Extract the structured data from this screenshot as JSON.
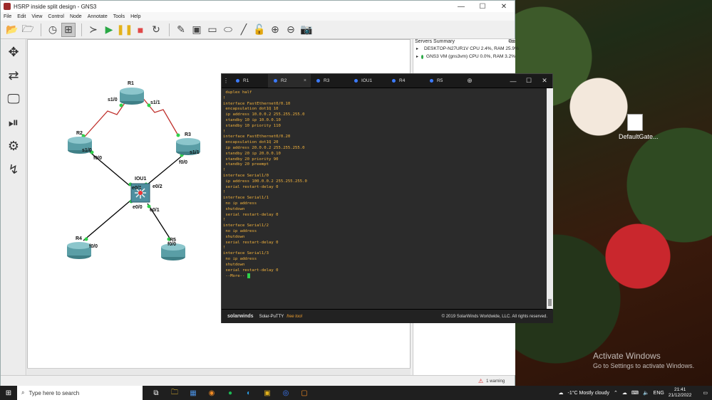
{
  "window": {
    "title": "HSRP inside split design - GNS3",
    "controls": [
      "—",
      "☐",
      "✕"
    ]
  },
  "menu": [
    "File",
    "Edit",
    "View",
    "Control",
    "Node",
    "Annotate",
    "Tools",
    "Help"
  ],
  "servers": {
    "title": "Servers Summary",
    "items": [
      {
        "label": "DESKTOP-N27UR1V CPU 2.4%, RAM 25.9%"
      },
      {
        "label": "GNS3 VM (gns3vm) CPU 0.0%, RAM 3.2%"
      }
    ]
  },
  "topology": {
    "nodes": {
      "R1": "R1",
      "R2": "R2",
      "R3": "R3",
      "IOU1": "IOU1",
      "R4": "R4",
      "R5": "R5"
    },
    "ports": {
      "r1_s10": "s1/0",
      "r1_s11": "s1/1",
      "r2_s10": "s1/0",
      "r2_f00": "f0/0",
      "r3_s11": "s1/1",
      "r3_f00": "f0/0",
      "iou_e01": "e0/1",
      "iou_e02": "e0/2",
      "iou_e00": "e0/0",
      "iou_e01b": "e0/1",
      "r4_f00": "f0/0",
      "r5_f00": "f0/0"
    }
  },
  "status": {
    "warning": "1 warning"
  },
  "putty": {
    "tabs": [
      "R1",
      "R2",
      "R3",
      "IOU1",
      "R4",
      "R5"
    ],
    "active_tab_close": "×",
    "terminal_lines": [
      " duplex half",
      "!",
      "interface FastEthernet0/0.10",
      " encapsulation dot1Q 10",
      " ip address 10.0.0.2 255.255.255.0",
      " standby 10 ip 10.0.0.10",
      " standby 10 priority 110",
      "!",
      "interface FastEthernet0/0.20",
      " encapsulation dot1Q 20",
      " ip address 20.0.0.2 255.255.255.0",
      " standby 20 ip 20.0.0.10",
      " standby 20 priority 90",
      " standby 20 preempt",
      "!",
      "interface Serial1/0",
      " ip address 100.0.0.2 255.255.255.0",
      " serial restart-delay 0",
      "!",
      "interface Serial1/1",
      " no ip address",
      " shutdown",
      " serial restart-delay 0",
      "!",
      "interface Serial1/2",
      " no ip address",
      " shutdown",
      " serial restart-delay 0",
      "!",
      "interface Serial1/3",
      " no ip address",
      " shutdown",
      " serial restart-delay 0"
    ],
    "more_prompt": " --More-- ",
    "footer_brand": "solarwinds",
    "footer_product": "Solar-PuTTY",
    "footer_free": "free tool",
    "footer_copyright": "© 2019 SolarWinds Worldwide, LLC. All rights reserved."
  },
  "desktop": {
    "icon_label": "DefaultGate...",
    "activate_title": "Activate Windows",
    "activate_sub": "Go to Settings to activate Windows."
  },
  "taskbar": {
    "search_placeholder": "Type here to search",
    "weather": "-1°C  Mostly cloudy",
    "lang": "ENG",
    "time": "21:41",
    "date": "21/12/2022"
  },
  "colors": {
    "terminal_text": "#f3b33d",
    "link_up": "#2fd14a",
    "serial_link": "#c0302c",
    "ethernet_link": "#000000"
  }
}
